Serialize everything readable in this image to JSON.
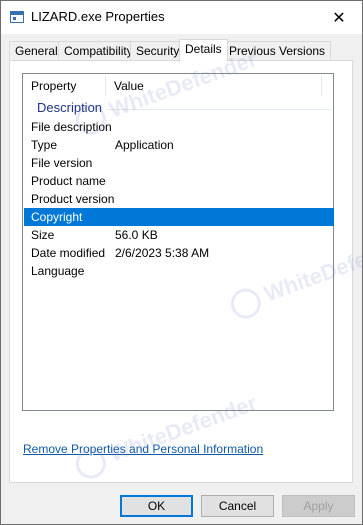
{
  "window": {
    "title": "LIZARD.exe Properties",
    "close_glyph": "✕"
  },
  "tabs": [
    {
      "label": "General"
    },
    {
      "label": "Compatibility"
    },
    {
      "label": "Security"
    },
    {
      "label": "Details",
      "active": true
    },
    {
      "label": "Previous Versions"
    }
  ],
  "details": {
    "columns": {
      "property": "Property",
      "value": "Value"
    },
    "group": "Description",
    "rows": [
      {
        "property": "File description",
        "value": ""
      },
      {
        "property": "Type",
        "value": "Application"
      },
      {
        "property": "File version",
        "value": ""
      },
      {
        "property": "Product name",
        "value": ""
      },
      {
        "property": "Product version",
        "value": ""
      },
      {
        "property": "Copyright",
        "value": "",
        "selected": true
      },
      {
        "property": "Size",
        "value": "56.0 KB"
      },
      {
        "property": "Date modified",
        "value": "2/6/2023 5:38 AM"
      },
      {
        "property": "Language",
        "value": ""
      }
    ],
    "remove_link": "Remove Properties and Personal Information"
  },
  "buttons": {
    "ok": "OK",
    "cancel": "Cancel",
    "apply": "Apply"
  },
  "watermark": {
    "text": "WhiteDefender"
  },
  "colors": {
    "selection": "#0078d7",
    "link": "#0f5aa8",
    "group_header": "#1e3287"
  }
}
